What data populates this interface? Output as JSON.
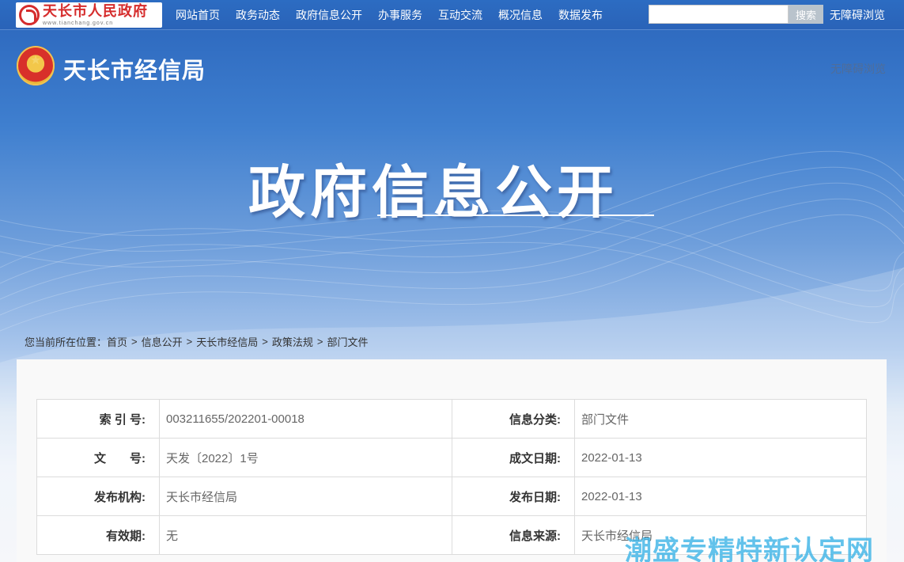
{
  "topbar": {
    "logo_title": "天长市人民政府",
    "logo_url": "www.tianchang.gov.cn",
    "nav": [
      "网站首页",
      "政务动态",
      "政府信息公开",
      "办事服务",
      "互动交流",
      "概况信息",
      "数据发布"
    ],
    "search_placeholder": "",
    "search_label": "搜索",
    "accessibility": "无障碍浏览"
  },
  "banner": {
    "dept_title": "天长市经信局",
    "accessibility": "无障碍浏览",
    "hero_title": "政府信息公开"
  },
  "breadcrumb": {
    "prefix": "您当前所在位置：",
    "items": [
      "首页",
      "信息公开",
      "天长市经信局",
      "政策法规",
      "部门文件"
    ],
    "separator": ">"
  },
  "meta": {
    "rows": [
      {
        "label1": "索 引 号:",
        "value1": "003211655/202201-00018",
        "label2": "信息分类:",
        "value2": "部门文件"
      },
      {
        "label1": "文　　号:",
        "value1": "天发〔2022〕1号",
        "label2": "成文日期:",
        "value2": "2022-01-13"
      },
      {
        "label1": "发布机构:",
        "value1": "天长市经信局",
        "label2": "发布日期:",
        "value2": "2022-01-13"
      },
      {
        "label1": "有效期:",
        "value1": "无",
        "label2": "信息来源:",
        "value2": "天长市经信局"
      }
    ]
  },
  "watermark": "潮盛专精特新认定网",
  "colors": {
    "topbar": "#2a63b8",
    "logo_red": "#d52c2c",
    "search_button": "#b9c3cc"
  }
}
